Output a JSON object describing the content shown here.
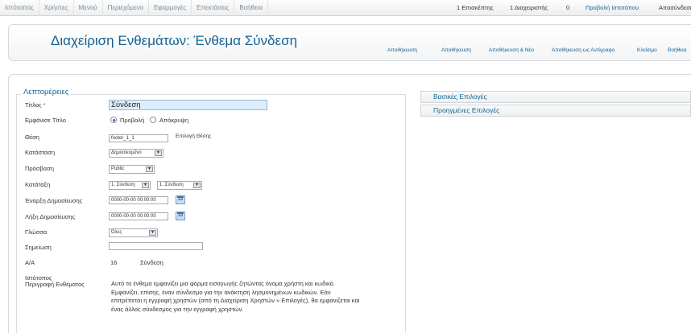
{
  "menu": [
    "Ιστότοπος",
    "Χρήστες",
    "Μενού",
    "Περιεχόμενο",
    "Εφαρμογές",
    "Επεκτάσεις",
    "Βοήθεια"
  ],
  "status": {
    "visitors": "1 Επισκέπτης",
    "admins": "1 Διαχειριστής",
    "messages": "0",
    "view_site": "Προβολή Ιστοτόπου",
    "logout": "Αποσύνδεση"
  },
  "header": {
    "title": "Διαχείριση Ενθεμάτων: Ένθεμα Σύνδεση"
  },
  "toolbar": [
    "Αποθήκευση",
    "Αποθήκευση",
    "Αποθήκευση & Νέο",
    "Αποθήκευση ως Αντίγραφο",
    "Κλείσιμο",
    "Βοήθεια"
  ],
  "details": {
    "legend": "Λεπτομέρειες",
    "title_label": "Τίτλος",
    "required_mark": "*",
    "title_value": "Σύνδεση",
    "show_title_label": "Εμφάνισε Τίτλο",
    "show_option": "Προβολή",
    "hide_option": "Απόκρυψη",
    "position_label": "Θέση",
    "position_value": "footer_1_1",
    "select_position": "Επιλογή Θέσης",
    "state_label": "Κατάσταση",
    "state_value": "Δημοσιευμένο",
    "access_label": "Πρόσβαση",
    "access_value": "Public",
    "ordering_label": "Κατάταξη",
    "ordering_value1": "1. Σύνδεση",
    "ordering_value2": "1. Σύνδεση",
    "publish_up_label": "Έναρξη Δημοσίευσης",
    "publish_up_value": "0000-00-00 00:00:00",
    "publish_down_label": "Λήξη Δημοσίευσης",
    "publish_down_value": "0000-00-00 00:00:00",
    "calendar_glyph": "33",
    "language_label": "Γλώσσα",
    "language_value": "Όλες",
    "note_label": "Σημείωση",
    "note_value": "",
    "id_label": "Α/Α",
    "id_value": "16",
    "id_name": "Σύνδεση",
    "site_label": "Ιστότοπος",
    "description_label": "Περιγραφή Ενθέματος",
    "description_lines": [
      "Αυτό το ένθεμα εμφανίζει μια φόρμα εισαγωγής ζητώντας όνομα χρήστη και κωδικό.",
      "Εμφανίζει, επίσης, έναν σύνδεσμο για την ανάκτηση λησμονημένων κωδικών. Εάν",
      "επιτρέπεται η εγγραφή χρηστών (από τη Διαχείριση Χρηστών » Επιλογές), θα εμφανίζεται και",
      "ένας άλλος σύνδεσμος για την εγγραφή χρηστών."
    ]
  },
  "panels": [
    "Βασικές Επιλογές",
    "Προηγμένες Επιλογές"
  ],
  "colors": {
    "link_blue": "#146295",
    "title_input_bg": "#dceefb",
    "required": "#e33333"
  }
}
